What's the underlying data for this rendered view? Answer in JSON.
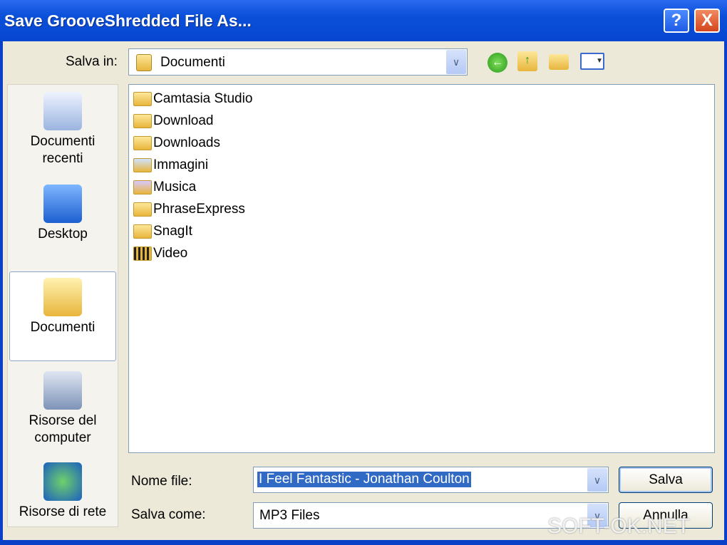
{
  "window": {
    "title": "Save GrooveShredded File As...",
    "help": "?",
    "close": "X"
  },
  "toolbar": {
    "save_in_label": "Salva in:",
    "save_in_value": "Documenti",
    "icons": [
      "back-icon",
      "up-folder-icon",
      "new-folder-icon",
      "view-menu-icon"
    ]
  },
  "places": [
    {
      "label": "Documenti recenti"
    },
    {
      "label": "Desktop"
    },
    {
      "label": "Documenti",
      "selected": true
    },
    {
      "label": "Risorse del computer"
    },
    {
      "label": "Risorse di rete"
    }
  ],
  "files": [
    {
      "name": "Camtasia Studio",
      "icon": "folder"
    },
    {
      "name": "Download",
      "icon": "folder"
    },
    {
      "name": "Downloads",
      "icon": "folder"
    },
    {
      "name": "Immagini",
      "icon": "pictures-folder"
    },
    {
      "name": "Musica",
      "icon": "music-folder"
    },
    {
      "name": "PhraseExpress",
      "icon": "folder"
    },
    {
      "name": "SnagIt",
      "icon": "folder"
    },
    {
      "name": "Video",
      "icon": "video-folder"
    }
  ],
  "form": {
    "filename_label": "Nome file:",
    "filename_value": "I Feel Fantastic - Jonathan Coulton",
    "savetype_label": "Salva come:",
    "savetype_value": "MP3 Files",
    "save_button": "Salva",
    "cancel_button": "Annulla"
  },
  "watermark": "SOFT-OK.NET"
}
